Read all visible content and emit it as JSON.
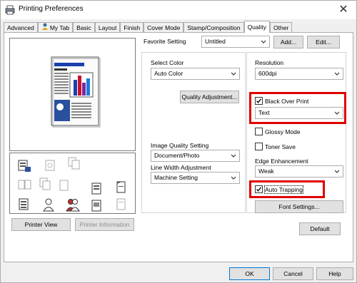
{
  "window": {
    "title": "Printing Preferences"
  },
  "tabs": [
    "Advanced",
    "My Tab",
    "Basic",
    "Layout",
    "Finish",
    "Cover Mode",
    "Stamp/Composition",
    "Quality",
    "Other"
  ],
  "favorite": {
    "label": "Favorite Setting",
    "value": "Untitled",
    "add_label": "Add...",
    "edit_label": "Edit..."
  },
  "select_color": {
    "label": "Select Color",
    "value": "Auto Color"
  },
  "quality_adjust_label": "Quality Adjustment...",
  "image_quality": {
    "label": "Image Quality Setting",
    "value": "Document/Photo"
  },
  "line_width": {
    "label": "Line Width Adjustment",
    "value": "Machine Setting"
  },
  "resolution": {
    "label": "Resolution",
    "value": "600dpi"
  },
  "black_over_print": {
    "label": "Black Over Print",
    "checked": true,
    "value": "Text"
  },
  "glossy_mode": {
    "label": "Glossy Mode",
    "checked": false
  },
  "toner_save": {
    "label": "Toner Save",
    "checked": false
  },
  "edge_enhancement": {
    "label": "Edge Enhancement",
    "value": "Weak"
  },
  "auto_trapping": {
    "label": "Auto Trapping",
    "checked": true
  },
  "font_settings_label": "Font Settings...",
  "default_label": "Default",
  "printer_view_label": "Printer View",
  "printer_info_label": "Printer Information",
  "footer": {
    "ok": "OK",
    "cancel": "Cancel",
    "help": "Help"
  },
  "colors": {
    "highlight": "#e00000",
    "accent": "#0078d7"
  }
}
